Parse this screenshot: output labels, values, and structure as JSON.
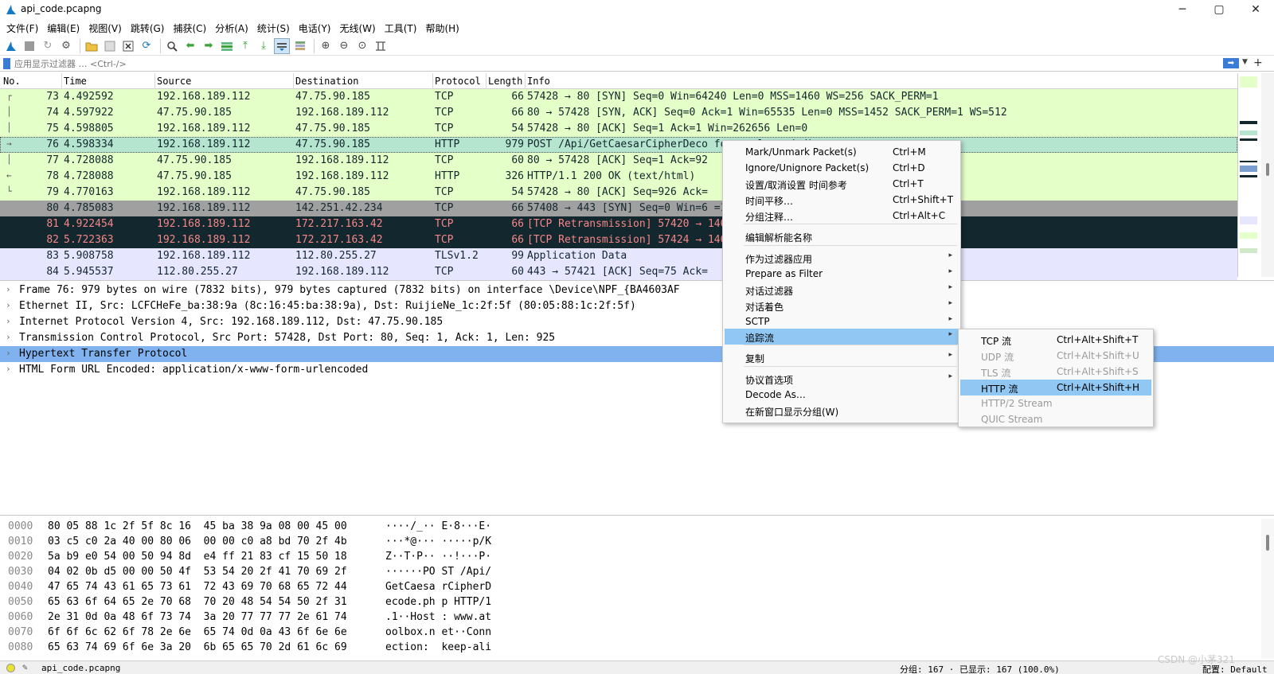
{
  "window": {
    "title": "api_code.pcapng",
    "minimize": "─",
    "maximize": "▢",
    "close": "✕"
  },
  "menu": [
    "文件(F)",
    "编辑(E)",
    "视图(V)",
    "跳转(G)",
    "捕获(C)",
    "分析(A)",
    "统计(S)",
    "电话(Y)",
    "无线(W)",
    "工具(T)",
    "帮助(H)"
  ],
  "filter": {
    "placeholder": "应用显示过滤器 … <Ctrl-/>"
  },
  "columns": {
    "no": "No.",
    "time": "Time",
    "source": "Source",
    "destination": "Destination",
    "protocol": "Protocol",
    "length": "Length",
    "info": "Info"
  },
  "packets": [
    {
      "no": "73",
      "time": "4.492592",
      "source": "192.168.189.112",
      "destination": "47.75.90.185",
      "protocol": "TCP",
      "length": "66",
      "info": "57428 → 80 [SYN] Seq=0 Win=64240 Len=0 MSS=1460 WS=256 SACK_PERM=1",
      "bg": "#e4ffc7",
      "fg": "#12272e",
      "rel": "┌"
    },
    {
      "no": "74",
      "time": "4.597922",
      "source": "47.75.90.185",
      "destination": "192.168.189.112",
      "protocol": "TCP",
      "length": "66",
      "info": "80 → 57428 [SYN, ACK] Seq=0 Ack=1 Win=65535 Len=0 MSS=1452 SACK_PERM=1 WS=512",
      "bg": "#e4ffc7",
      "fg": "#12272e",
      "rel": "│"
    },
    {
      "no": "75",
      "time": "4.598805",
      "source": "192.168.189.112",
      "destination": "47.75.90.185",
      "protocol": "TCP",
      "length": "54",
      "info": "57428 → 80 [ACK] Seq=1 Ack=1 Win=262656 Len=0",
      "bg": "#e4ffc7",
      "fg": "#12272e",
      "rel": "│"
    },
    {
      "no": "76",
      "time": "4.598334",
      "source": "192.168.189.112",
      "destination": "47.75.90.185",
      "protocol": "HTTP",
      "length": "979",
      "info": "POST /Api/GetCaesarCipherDeco                                         form-urlencoded)",
      "bg": "#b5e4cf",
      "fg": "#12272e",
      "rel": "→",
      "selected": true
    },
    {
      "no": "77",
      "time": "4.728088",
      "source": "47.75.90.185",
      "destination": "192.168.189.112",
      "protocol": "TCP",
      "length": "60",
      "info": "80 → 57428 [ACK] Seq=1 Ack=92",
      "bg": "#e4ffc7",
      "fg": "#12272e",
      "rel": "│"
    },
    {
      "no": "78",
      "time": "4.728088",
      "source": "47.75.90.185",
      "destination": "192.168.189.112",
      "protocol": "HTTP",
      "length": "326",
      "info": "HTTP/1.1 200 OK  (text/html)",
      "bg": "#e4ffc7",
      "fg": "#12272e",
      "rel": "←"
    },
    {
      "no": "79",
      "time": "4.770163",
      "source": "192.168.189.112",
      "destination": "47.75.90.185",
      "protocol": "TCP",
      "length": "54",
      "info": "57428 → 80 [ACK] Seq=926 Ack=",
      "bg": "#e4ffc7",
      "fg": "#12272e",
      "rel": "└"
    },
    {
      "no": "80",
      "time": "4.785083",
      "source": "192.168.189.112",
      "destination": "142.251.42.234",
      "protocol": "TCP",
      "length": "66",
      "info": "57408 → 443 [SYN] Seq=0 Win=6                                   =1",
      "bg": "#a0a0a0",
      "fg": "#12272e",
      "rel": ""
    },
    {
      "no": "81",
      "time": "4.922454",
      "source": "192.168.189.112",
      "destination": "172.217.163.42",
      "protocol": "TCP",
      "length": "66",
      "info": "[TCP Retransmission] 57420 →                                   1460 WS=256 SACK_PERM=1",
      "bg": "#12272e",
      "fg": "#f78787",
      "rel": ""
    },
    {
      "no": "82",
      "time": "5.722363",
      "source": "192.168.189.112",
      "destination": "172.217.163.42",
      "protocol": "TCP",
      "length": "66",
      "info": "[TCP Retransmission] 57424 →                                   1460 WS=256 SACK_PERM=1",
      "bg": "#12272e",
      "fg": "#f78787",
      "rel": ""
    },
    {
      "no": "83",
      "time": "5.908758",
      "source": "192.168.189.112",
      "destination": "112.80.255.27",
      "protocol": "TLSv1.2",
      "length": "99",
      "info": "Application Data",
      "bg": "#e7e6ff",
      "fg": "#12272e",
      "rel": ""
    },
    {
      "no": "84",
      "time": "5.945537",
      "source": "112.80.255.27",
      "destination": "192.168.189.112",
      "protocol": "TCP",
      "length": "60",
      "info": "443 → 57421 [ACK] Seq=75 Ack=",
      "bg": "#e7e6ff",
      "fg": "#12272e",
      "rel": ""
    }
  ],
  "details": [
    {
      "text": "Frame 76: 979 bytes on wire (7832 bits), 979 bytes captured (7832 bits) on interface \\Device\\NPF_{BA4603AF",
      "selected": false
    },
    {
      "text": "Ethernet II, Src: LCFCHeFe_ba:38:9a (8c:16:45:ba:38:9a), Dst: RuijieNe_1c:2f:5f (80:05:88:1c:2f:5f)",
      "selected": false
    },
    {
      "text": "Internet Protocol Version 4, Src: 192.168.189.112, Dst: 47.75.90.185",
      "selected": false
    },
    {
      "text": "Transmission Control Protocol, Src Port: 57428, Dst Port: 80, Seq: 1, Ack: 1, Len: 925",
      "selected": false
    },
    {
      "text": "Hypertext Transfer Protocol",
      "selected": true
    },
    {
      "text": "HTML Form URL Encoded: application/x-www-form-urlencoded",
      "selected": false
    }
  ],
  "bytes": [
    {
      "offset": "0000",
      "hex": "80 05 88 1c 2f 5f 8c 16  45 ba 38 9a 08 00 45 00",
      "ascii": "····/_·· E·8···E·"
    },
    {
      "offset": "0010",
      "hex": "03 c5 c0 2a 40 00 80 06  00 00 c0 a8 bd 70 2f 4b",
      "ascii": "···*@··· ·····p/K"
    },
    {
      "offset": "0020",
      "hex": "5a b9 e0 54 00 50 94 8d  e4 ff 21 83 cf 15 50 18",
      "ascii": "Z··T·P·· ··!···P·"
    },
    {
      "offset": "0030",
      "hex": "04 02 0b d5 00 00 50 4f  53 54 20 2f 41 70 69 2f",
      "ascii": "······PO ST /Api/"
    },
    {
      "offset": "0040",
      "hex": "47 65 74 43 61 65 73 61  72 43 69 70 68 65 72 44",
      "ascii": "GetCaesa rCipherD"
    },
    {
      "offset": "0050",
      "hex": "65 63 6f 64 65 2e 70 68  70 20 48 54 54 50 2f 31",
      "ascii": "ecode.ph p HTTP/1"
    },
    {
      "offset": "0060",
      "hex": "2e 31 0d 0a 48 6f 73 74  3a 20 77 77 77 2e 61 74",
      "ascii": ".1··Host : www.at"
    },
    {
      "offset": "0070",
      "hex": "6f 6f 6c 62 6f 78 2e 6e  65 74 0d 0a 43 6f 6e 6e",
      "ascii": "oolbox.n et··Conn"
    },
    {
      "offset": "0080",
      "hex": "65 63 74 69 6f 6e 3a 20  6b 65 65 70 2d 61 6c 69",
      "ascii": "ection:  keep-ali"
    }
  ],
  "context_menu": {
    "items": [
      {
        "label": "Mark/Unmark Packet(s)",
        "shortcut": "Ctrl+M"
      },
      {
        "label": "Ignore/Unignore Packet(s)",
        "shortcut": "Ctrl+D"
      },
      {
        "label": "设置/取消设置 时间参考",
        "shortcut": "Ctrl+T"
      },
      {
        "label": "时间平移…",
        "shortcut": "Ctrl+Shift+T"
      },
      {
        "label": "分组注释…",
        "shortcut": "Ctrl+Alt+C"
      },
      {
        "label": "编辑解析能名称",
        "shortcut": ""
      },
      {
        "label": "作为过滤器应用",
        "shortcut": ""
      },
      {
        "label": "Prepare as Filter",
        "shortcut": ""
      },
      {
        "label": "对话过滤器",
        "shortcut": ""
      },
      {
        "label": "对话着色",
        "shortcut": ""
      },
      {
        "label": "SCTP",
        "shortcut": ""
      },
      {
        "label": "追踪流",
        "shortcut": ""
      },
      {
        "label": "复制",
        "shortcut": ""
      },
      {
        "label": "协议首选项",
        "shortcut": ""
      },
      {
        "label": "Decode As…",
        "shortcut": ""
      },
      {
        "label": "在新窗口显示分组(W)",
        "shortcut": ""
      }
    ]
  },
  "follow_submenu": {
    "items": [
      {
        "label": "TCP 流",
        "shortcut": "Ctrl+Alt+Shift+T",
        "disabled": false
      },
      {
        "label": "UDP 流",
        "shortcut": "Ctrl+Alt+Shift+U",
        "disabled": true
      },
      {
        "label": "TLS 流",
        "shortcut": "Ctrl+Alt+Shift+S",
        "disabled": true
      },
      {
        "label": "HTTP 流",
        "shortcut": "Ctrl+Alt+Shift+H",
        "disabled": false
      },
      {
        "label": "HTTP/2 Stream",
        "shortcut": "",
        "disabled": true
      },
      {
        "label": "QUIC Stream",
        "shortcut": "",
        "disabled": true
      }
    ]
  },
  "status": {
    "file": "api_code.pcapng",
    "counts": "分组: 167 · 已显示: 167 (100.0%)",
    "profile": "配置: Default"
  },
  "watermark": "CSDN @小茅321",
  "colors": {
    "selected_detail": "#7fb2ee",
    "menu_highlight": "#91c7f3"
  }
}
